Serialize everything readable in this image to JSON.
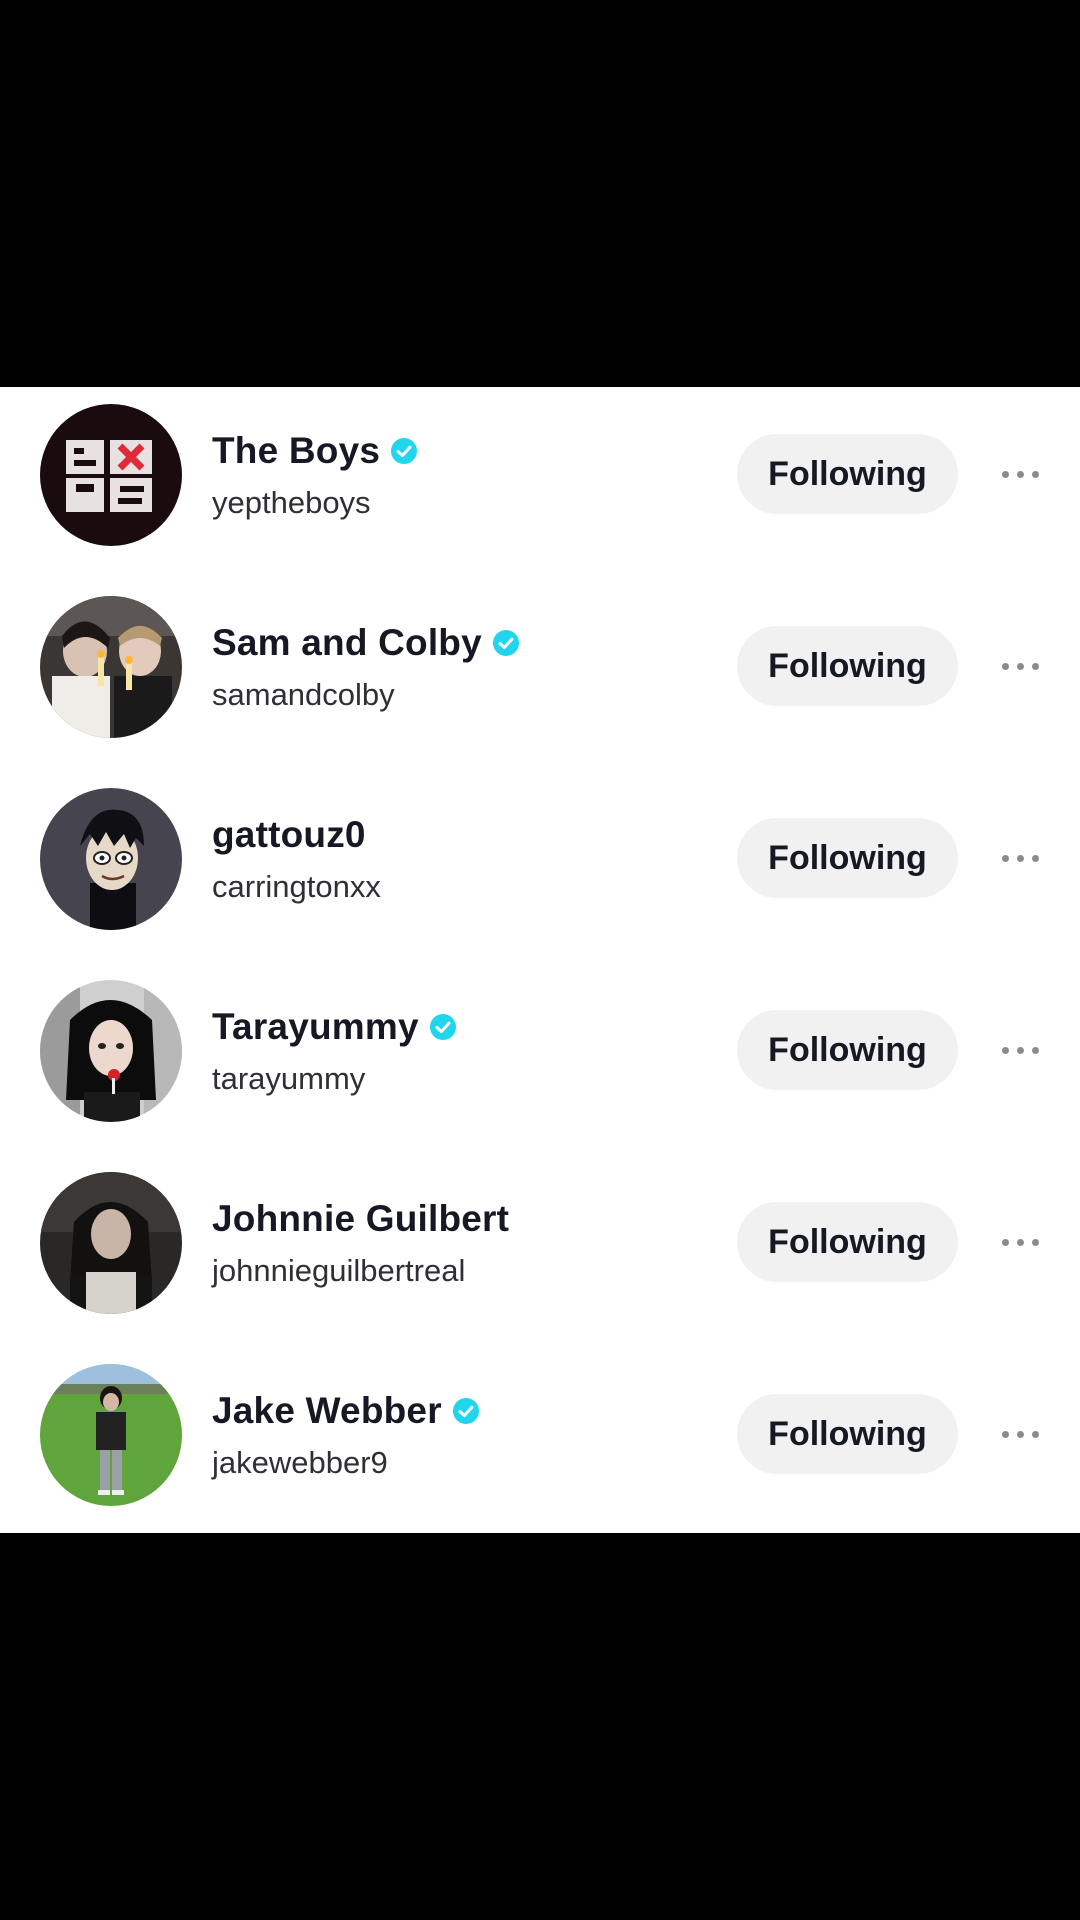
{
  "colors": {
    "background": "#000000",
    "panel": "#ffffff",
    "verified_badge": "#20d5ec",
    "button_bg": "#f1f1f2",
    "text_primary": "#161823"
  },
  "accounts": [
    {
      "display_name": "The Boys",
      "username": "yeptheboys",
      "verified": true,
      "button_label": "Following",
      "more_icon": "ellipsis-icon"
    },
    {
      "display_name": "Sam and Colby",
      "username": "samandcolby",
      "verified": true,
      "button_label": "Following",
      "more_icon": "ellipsis-icon"
    },
    {
      "display_name": "gattouz0",
      "username": "carringtonxx",
      "verified": false,
      "button_label": "Following",
      "more_icon": "ellipsis-icon"
    },
    {
      "display_name": "Tarayummy",
      "username": "tarayummy",
      "verified": true,
      "button_label": "Following",
      "more_icon": "ellipsis-icon"
    },
    {
      "display_name": "Johnnie Guilbert",
      "username": "johnnieguilbertreal",
      "verified": false,
      "button_label": "Following",
      "more_icon": "ellipsis-icon"
    },
    {
      "display_name": "Jake Webber",
      "username": "jakewebber9",
      "verified": true,
      "button_label": "Following",
      "more_icon": "ellipsis-icon"
    }
  ]
}
